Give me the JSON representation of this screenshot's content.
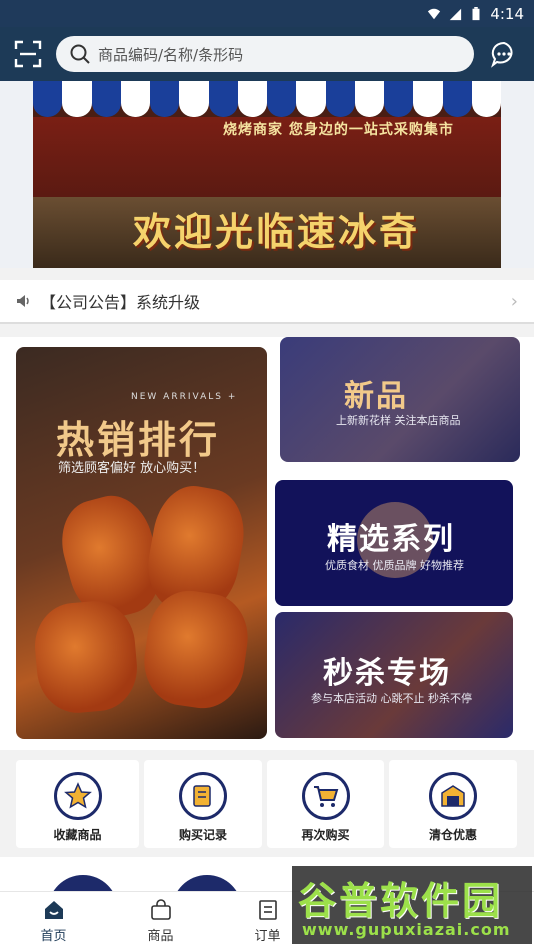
{
  "status_bar": {
    "time": "4:14"
  },
  "header": {
    "search_placeholder": "商品编码/名称/条形码"
  },
  "banner": {
    "subtitle": "烧烤商家 您身边的一站式采购集市",
    "title": "欢迎光临速冰奇"
  },
  "notice": {
    "text": "【公司公告】系统升级"
  },
  "promo": {
    "hot": {
      "tag": "NEW ARRIVALS +",
      "title": "热销排行",
      "subtitle": "筛选顾客偏好 放心购买！"
    },
    "new": {
      "title": "新品",
      "subtitle": "上新新花样 关注本店商品"
    },
    "selected": {
      "title": "精选系列",
      "subtitle": "优质食材 优质品牌 好物推荐"
    },
    "flash": {
      "title": "秒杀专场",
      "subtitle": "参与本店活动 心跳不止 秒杀不停"
    }
  },
  "shortcuts": [
    {
      "label": "收藏商品",
      "icon": "star-icon"
    },
    {
      "label": "购买记录",
      "icon": "record-icon"
    },
    {
      "label": "再次购买",
      "icon": "cart-icon"
    },
    {
      "label": "清仓优惠",
      "icon": "warehouse-icon"
    }
  ],
  "tabbar": [
    {
      "label": "首页",
      "icon": "home-icon",
      "active": true
    },
    {
      "label": "商品",
      "icon": "bag-icon"
    },
    {
      "label": "订单",
      "icon": "order-icon"
    }
  ],
  "watermark": {
    "title": "谷普软件园",
    "url": "www.gupuxiazai.com"
  },
  "colors": {
    "header": "#1d3a57",
    "navy": "#1d2a6a",
    "gold": "#f5d36c"
  }
}
